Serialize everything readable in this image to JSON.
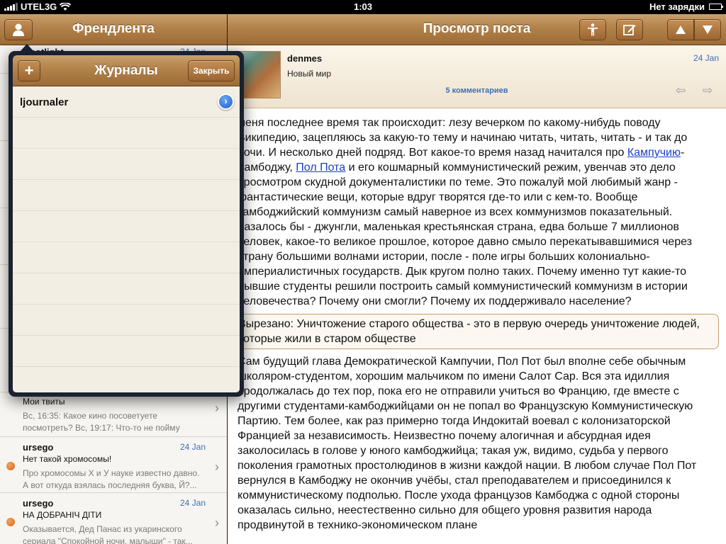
{
  "status": {
    "carrier": "UTEL3G",
    "time": "1:03",
    "battery": "Нет зарядки"
  },
  "left": {
    "title": "Френдлента",
    "peek_title": "potlight",
    "peek_date": "24 Jan",
    "rows": [
      {
        "author": "",
        "date": "",
        "title": "Мои твиты",
        "preview": "Вс, 16:35: Какое кино посоветуете посмотреть? Вс, 19:17: Что-то не пойму даж...",
        "unread": false
      },
      {
        "author": "ursego",
        "date": "24 Jan",
        "title": "Нет такой хромосомы!",
        "preview": "Про хромосомы X и У науке известно давно. А вот откуда взялась последняя буква, Й?...",
        "unread": true
      },
      {
        "author": "ursego",
        "date": "24 Jan",
        "title": "НА ДОБРАНІЧ ДІТИ",
        "preview": "Оказывается, Дед Панас из укаринского сериала \"Спокойной ночи, малыши\" - так...",
        "unread": true
      }
    ]
  },
  "popover": {
    "title": "Журналы",
    "add_label": "+",
    "close_label": "Закрыть",
    "items": [
      "ljournaler"
    ]
  },
  "right": {
    "title": "Просмотр поста",
    "author": "denmes",
    "subject": "Новый мир",
    "date": "24 Jan",
    "comments": "5 комментариев",
    "p1_a": "меня последнее время так происходит: лезу вечерком по какому-нибудь поводу Википедию, зацепляюсь за какую-то тему и начинаю читать, читать, читать - и так до ночи. И несколько дней подряд. Вот какое-то время назад начитался про ",
    "link1": "Кампучию",
    "p1_b": "-Камбоджу, ",
    "link2": "Пол Пота",
    "p1_c": " и его кошмарный коммунистический режим, увенчав это дело просмотром скудной документалистики по теме. Это пожалуй мой любимый жанр - фантастические вещи, которые вдруг творятся где-то или с кем-то. Вообще камбоджийский коммунизм самый наверное из всех коммунизмов показательный. Казалось бы - джунгли, маленькая крестьянская страна, едва больше 7 миллионов человек, какое-то великое прошлое, которое давно смыло перекатывавшимися через страну большими волнами истории, после - поле игры больших колониально-империалистичных государств. Дык кругом полно таких. Почему именно тут какие-то бывшие студенты решили построить самый коммунистический коммунизм в истории человечества? Почему они смогли? Почему их поддерживало население?",
    "cut": "Вырезано: Уничтожение старого общества - это в первую очередь уничтожение людей, которые жили в старом обществе",
    "p2": "Сам будущий глава Демократической Кампучии, Пол Пот был вполне себе обычным школяром-студентом, хорошим мальчиком по имени Салот Сар. Вся эта идиллия продолжалась до тех пор, пока его не отправили учиться во Францию, где вместе с другими студентами-камбоджийцами он не попал во Французскую Коммунистическую Партию. Тем более, как раз примерно тогда Индокитай воевал с колонизаторской Францией за независимость. Неизвестно почему алогичная и абсурдная идея заколосилась в голове у юного камбоджийца; такая уж, видимо, судьба у первого поколения грамотных простолюдинов в жизни каждой нации. В любом случае Пол Пот вернулся в Камбоджу не окончив учёбы, стал преподавателем и присоединился к коммунистическому подполью. После ухода французов Камбоджа с одной стороны оказалась сильно, неестественно сильно для общего уровня развития народа продвинутой в технико-экономическом плане"
  },
  "icons": {
    "profile": "person-icon",
    "userinfo": "accessibility-icon",
    "compose": "compose-icon",
    "up": "up-arrow-icon",
    "down": "down-arrow-icon"
  }
}
